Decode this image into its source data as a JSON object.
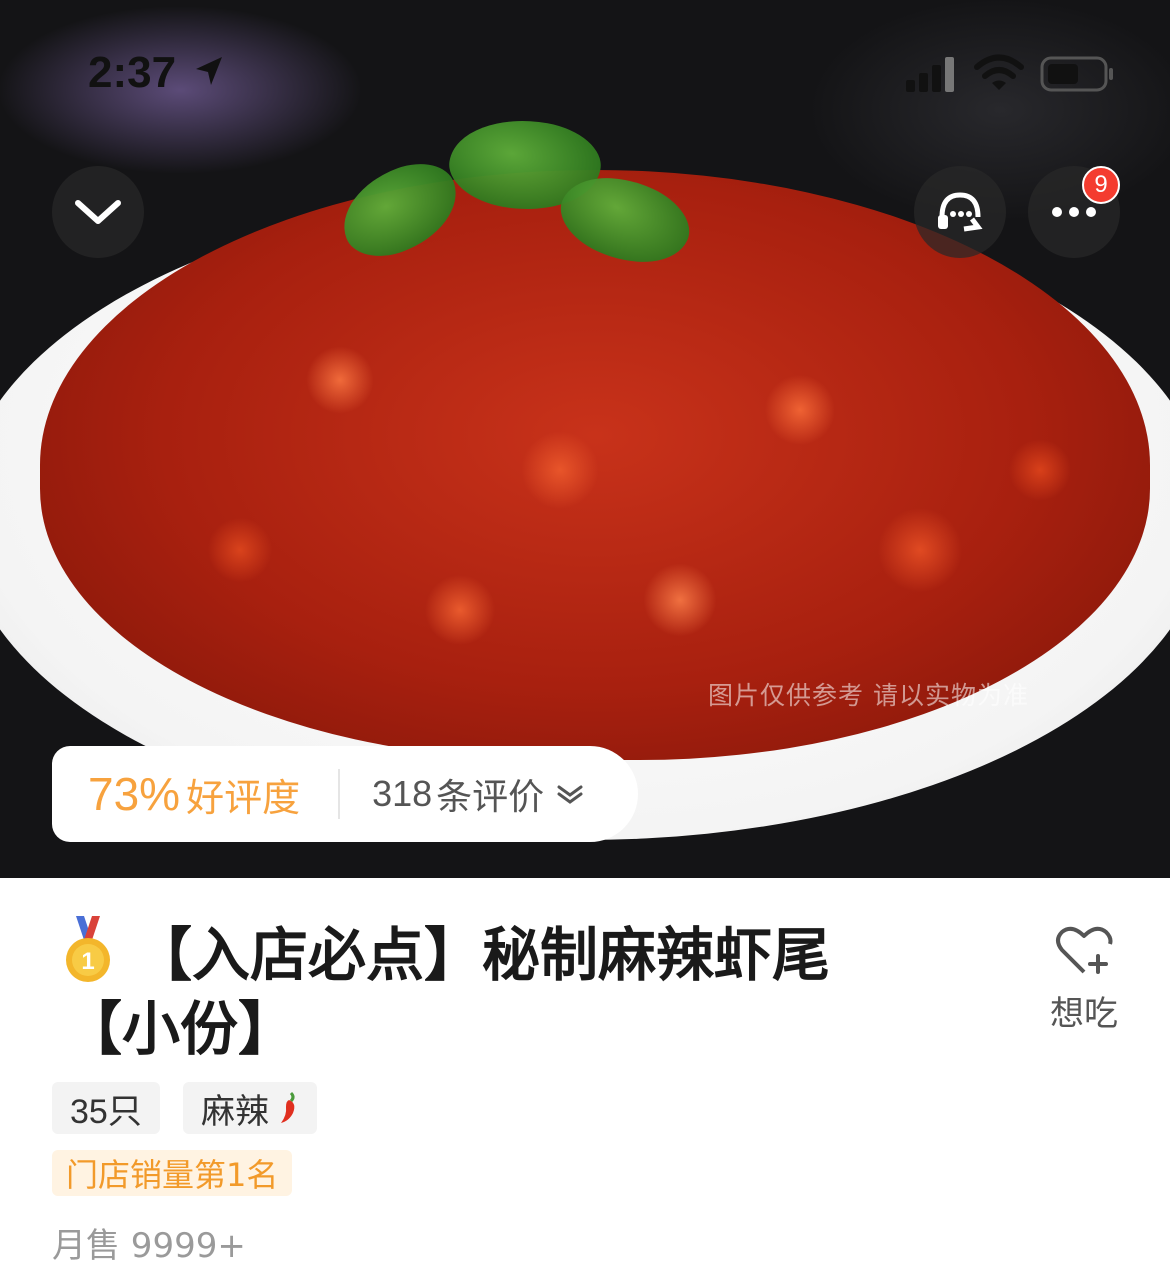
{
  "status_bar": {
    "time": "2:37",
    "icons": [
      "location-arrow-icon",
      "signal-icon",
      "wifi-icon",
      "battery-icon"
    ]
  },
  "hero": {
    "watermark": "图片仅供参考 请以实物为准",
    "buttons": {
      "collapse_icon": "chevron-down-icon",
      "service_icon": "customer-service-icon",
      "more_icon": "more-icon",
      "more_badge": "9"
    }
  },
  "rating": {
    "percent": "73%",
    "label": "好评度",
    "count": "318",
    "count_label": "条评价"
  },
  "product": {
    "medal_icon": "gold-medal-icon",
    "title": "【入店必点】秘制麻辣虾尾【小份】",
    "wish_label": "想吃",
    "tags": [
      "35只",
      "麻辣"
    ],
    "rank": "门店销量第1名",
    "monthly_sales": "月售 9999+"
  },
  "colors": {
    "accent_orange": "#f7a23e",
    "badge_red": "#f43c2f",
    "rank_bg": "#fff3e2"
  }
}
